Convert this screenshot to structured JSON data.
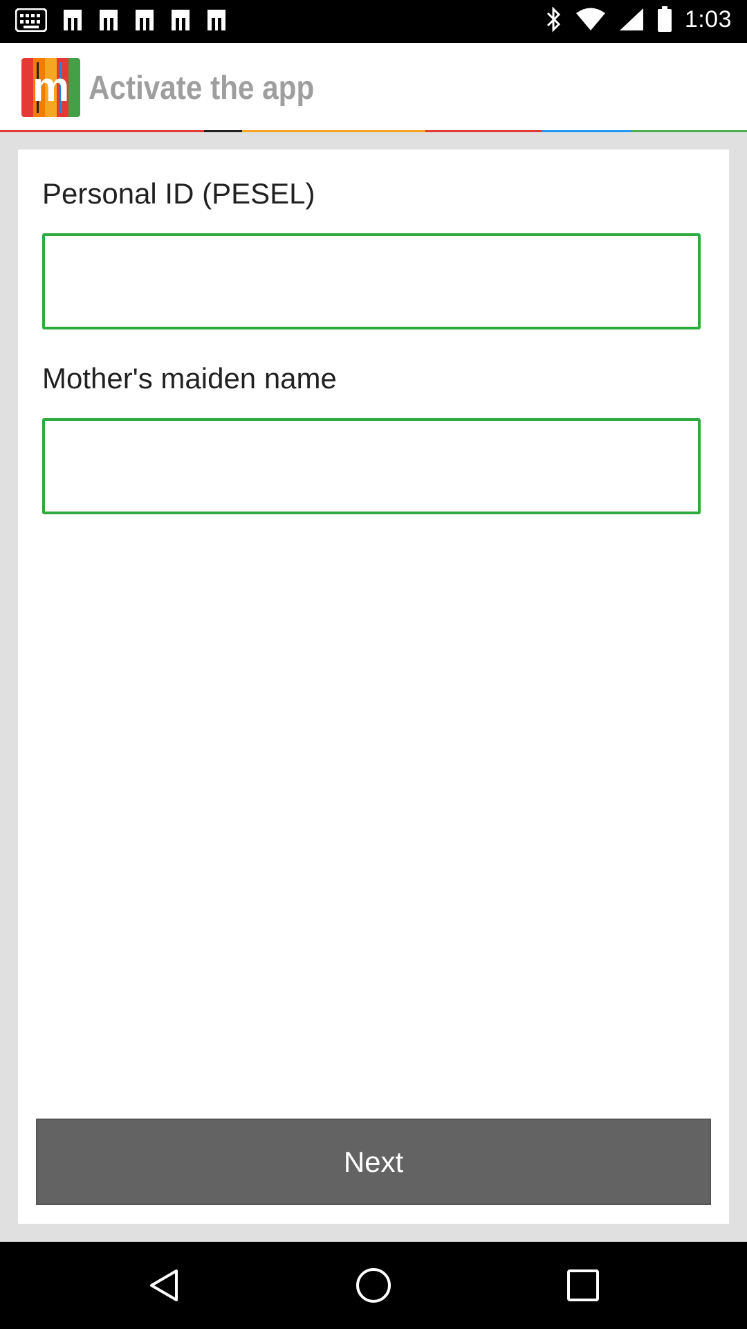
{
  "status_bar": {
    "time": "1:03",
    "left_icons": [
      "notification-icon",
      "app-notification-icon",
      "app-notification-icon",
      "app-notification-icon",
      "app-notification-icon",
      "app-notification-icon"
    ],
    "right_icons": [
      "bluetooth-icon",
      "wifi-icon",
      "signal-icon",
      "battery-icon"
    ]
  },
  "app_bar": {
    "title": "Activate the app",
    "logo_letter": "m",
    "accent_colors": [
      "#e53935",
      "#212121",
      "#f5a623",
      "#e53935",
      "#2196f3",
      "#4caf50"
    ]
  },
  "form": {
    "pesel_label": "Personal ID (PESEL)",
    "pesel_value": "",
    "maiden_label": "Mother's maiden name",
    "maiden_value": "",
    "input_border_color": "#2eaa3e"
  },
  "next_button": {
    "label": "Next",
    "color": "#646363"
  },
  "nav_bar": {
    "buttons": [
      "back-icon",
      "home-icon",
      "recents-icon"
    ]
  }
}
